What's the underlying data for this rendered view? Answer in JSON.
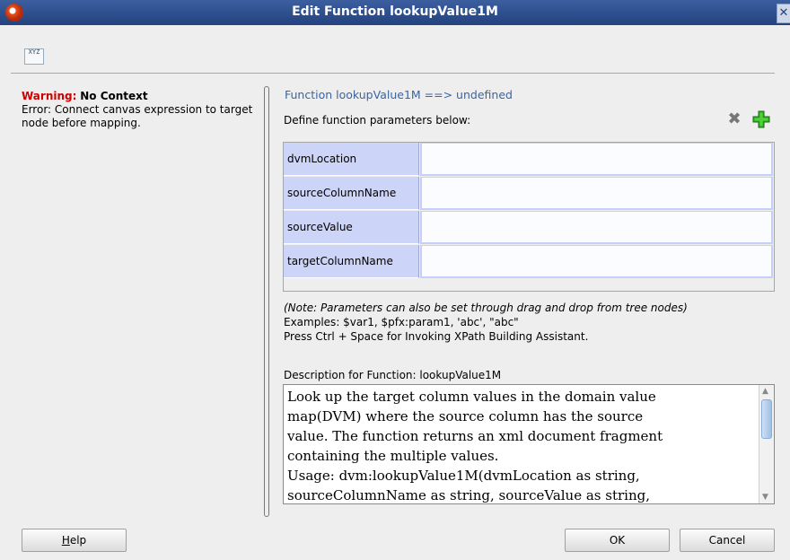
{
  "window": {
    "title": "Edit Function lookupValue1M",
    "close_glyph": "✕"
  },
  "toolbar": {
    "icon": "xpath-icon",
    "icon_text": "XYZ"
  },
  "warning": {
    "label": "Warning:",
    "title": "No Context",
    "message": "Error: Connect canvas expression to target node before mapping."
  },
  "function": {
    "signature": "Function lookupValue1M ==> undefined",
    "define_label": "Define function parameters below:",
    "delete_icon": "delete-icon",
    "add_icon": "add-icon"
  },
  "parameters": [
    {
      "name": "dvmLocation",
      "value": ""
    },
    {
      "name": "sourceColumnName",
      "value": ""
    },
    {
      "name": "sourceValue",
      "value": ""
    },
    {
      "name": "targetColumnName",
      "value": ""
    }
  ],
  "notes": {
    "line1": "(Note: Parameters can also be set through drag and drop from tree nodes)",
    "line2": "Examples: $var1, $pfx:param1, 'abc', \"abc\"",
    "line3": "Press Ctrl + Space for Invoking XPath Building Assistant."
  },
  "description": {
    "label": "Description for Function: lookupValue1M",
    "text_line1": "Look up the target column values in the domain value",
    "text_line2": "map(DVM) where the source column has the source",
    "text_line3": "value. The function returns an xml document fragment",
    "text_line4": "containing the multiple values.",
    "text_line5": "Usage: dvm:lookupValue1M(dvmLocation as string,",
    "text_line6": "sourceColumnName as string, sourceValue as string,"
  },
  "buttons": {
    "help_first": "H",
    "help_rest": "elp",
    "ok": "OK",
    "cancel": "Cancel"
  },
  "colors": {
    "title_bar": "#2f5291",
    "warning": "#cc0000",
    "signature": "#3a64a6",
    "param_name_bg": "#ccd4f7"
  }
}
